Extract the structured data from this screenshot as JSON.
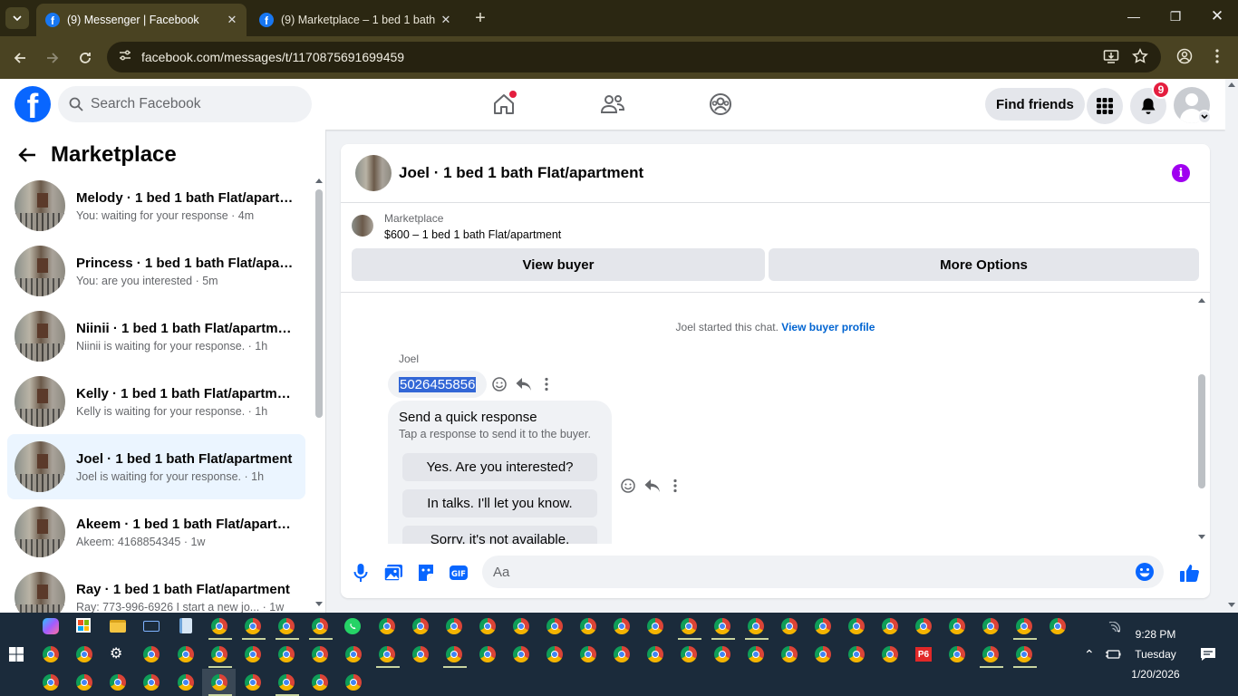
{
  "browser": {
    "tabs": [
      {
        "title": "(9) Messenger | Facebook",
        "active": true
      },
      {
        "title": "(9) Marketplace – 1 bed 1 bath F",
        "active": false
      }
    ],
    "url": "facebook.com/messages/t/1170875691699459"
  },
  "header": {
    "search_placeholder": "Search Facebook",
    "find_friends": "Find friends",
    "notification_count": "9",
    "logo_letter": "f"
  },
  "sidebar": {
    "title": "Marketplace",
    "conversations": [
      {
        "name": "Melody · 1 bed 1 bath Flat/apartment",
        "preview": "You: waiting for your response · 4m"
      },
      {
        "name": "Princess · 1 bed 1 bath Flat/apartment",
        "preview": "You: are you interested · 5m"
      },
      {
        "name": "Niinii · 1 bed 1 bath Flat/apartment",
        "preview": "Niinii is waiting for your response. · 1h"
      },
      {
        "name": "Kelly · 1 bed 1 bath Flat/apartment",
        "preview": "Kelly is waiting for your response. · 1h"
      },
      {
        "name": "Joel · 1 bed 1 bath Flat/apartment",
        "preview": "Joel is waiting for your response. · 1h",
        "selected": true
      },
      {
        "name": "Akeem · 1 bed 1 bath Flat/apartment",
        "preview": "Akeem: 4168854345 · 1w"
      },
      {
        "name": "Ray · 1 bed 1 bath Flat/apartment",
        "preview": "Ray: 773-996-6926 I start a new jo... · 1w"
      }
    ]
  },
  "chat": {
    "title": "Joel · 1 bed 1 bath Flat/apartment",
    "info_letter": "i",
    "listing": {
      "category": "Marketplace",
      "price_title": "$600 – 1 bed 1 bath Flat/apartment",
      "view_buyer": "View buyer",
      "more_options": "More Options"
    },
    "started_text": "Joel started this chat. ",
    "view_buyer_profile": "View buyer profile",
    "sender": "Joel",
    "message": "5026455856",
    "quick_response": {
      "heading": "Send a quick response",
      "subheading": "Tap a response to send it to the buyer.",
      "options": [
        "Yes. Are you interested?",
        "In talks. I'll let you know.",
        "Sorry, it's not available."
      ]
    },
    "composer_placeholder": "Aa"
  },
  "taskbar": {
    "time": "9:28 PM",
    "day": "Tuesday",
    "date": "1/20/2026",
    "p6_label": "P6"
  }
}
